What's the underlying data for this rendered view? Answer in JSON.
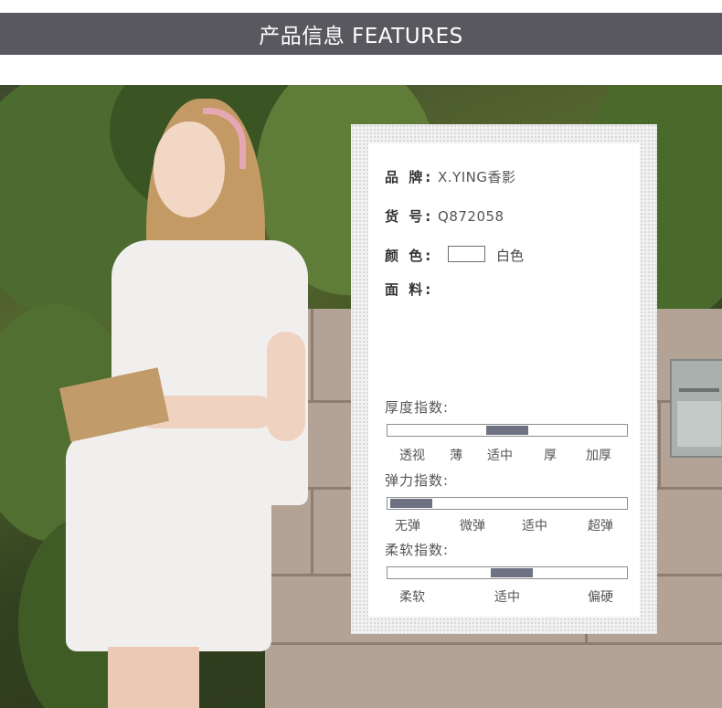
{
  "header": {
    "title": "产品信息 FEATURES"
  },
  "product": {
    "brand_label": "品  牌:",
    "brand_value": "X.YING香影",
    "sku_label": "货  号:",
    "sku_value": "Q872058",
    "color_label": "颜  色:",
    "color_value": "白色",
    "color_swatch": "#ffffff",
    "fabric_label": "面  料:"
  },
  "indices": {
    "thickness": {
      "title": "厚度指数:",
      "labels": [
        "透视",
        "薄",
        "适中",
        "厚",
        "加厚"
      ],
      "selected": "适中",
      "level": 0.5
    },
    "elasticity": {
      "title": "弹力指数:",
      "labels": [
        "无弹",
        "微弹",
        "适中",
        "超弹"
      ],
      "selected": "无弹",
      "level": 0.1
    },
    "softness": {
      "title": "柔软指数:",
      "labels": [
        "柔软",
        "适中",
        "偏硬"
      ],
      "selected": "适中",
      "level": 0.52
    }
  },
  "colors": {
    "banner": "#59585f",
    "indicator": "#6e7283"
  }
}
